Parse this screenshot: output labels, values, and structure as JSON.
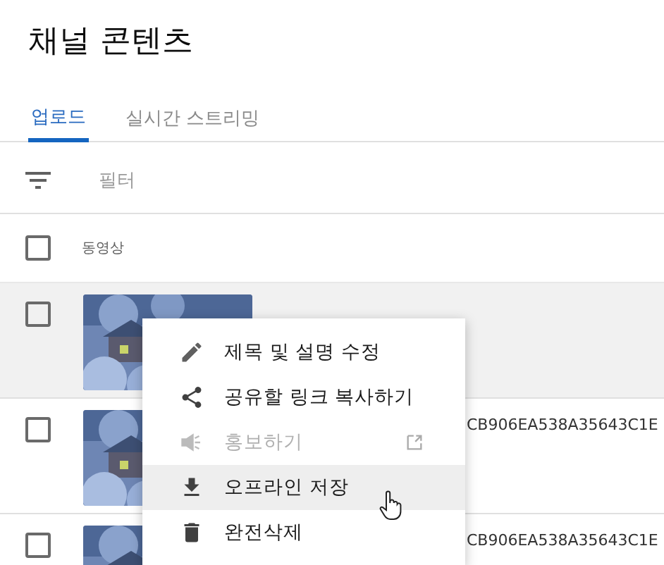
{
  "page_title": "채널 콘텐츠",
  "tabs": [
    {
      "label": "업로드",
      "selected": true
    },
    {
      "label": "실시간 스트리밍",
      "selected": false
    }
  ],
  "filter": {
    "placeholder": "필터"
  },
  "table": {
    "header": {
      "label": "동영상",
      "checked": false
    },
    "rows": [
      {
        "checked": false,
        "hovered": true
      },
      {
        "checked": false,
        "hovered": false,
        "id_text": "CB906EA538A35643C1E"
      },
      {
        "checked": false,
        "hovered": false,
        "id_text": "CB906EA538A35643C1E"
      }
    ]
  },
  "context_menu": {
    "items": [
      {
        "kind": "edit",
        "label": "제목 및 설명 수정",
        "disabled": false,
        "hovered": false
      },
      {
        "kind": "share",
        "label": "공유할 링크 복사하기",
        "disabled": false,
        "hovered": false
      },
      {
        "kind": "promote",
        "label": "홍보하기",
        "disabled": true,
        "hovered": false,
        "external": true
      },
      {
        "kind": "download",
        "label": "오프라인 저장",
        "disabled": false,
        "hovered": true
      },
      {
        "kind": "delete",
        "label": "완전삭제",
        "disabled": false,
        "hovered": false
      }
    ]
  }
}
